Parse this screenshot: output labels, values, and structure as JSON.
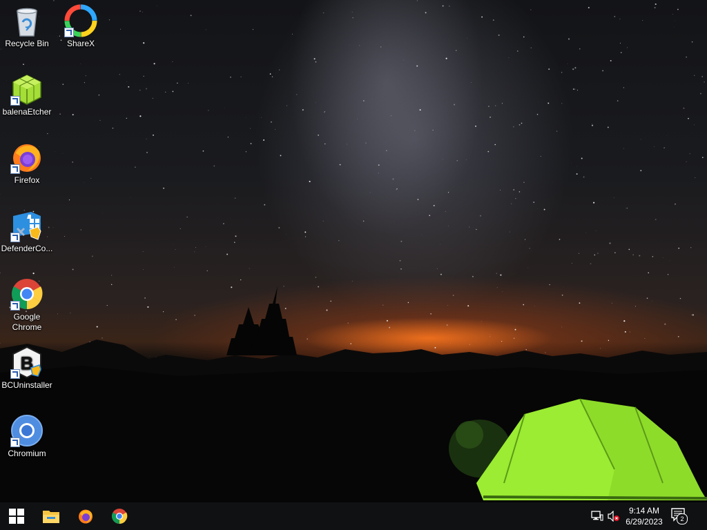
{
  "desktop": {
    "icons": [
      {
        "label": "Recycle Bin",
        "icon": "recycle-bin-icon",
        "shortcut": false
      },
      {
        "label": "ShareX",
        "icon": "sharex-icon",
        "shortcut": true
      },
      {
        "label": "balenaEtcher",
        "icon": "balena-etcher-icon",
        "shortcut": true
      },
      {
        "label": "Firefox",
        "icon": "firefox-icon",
        "shortcut": true
      },
      {
        "label": "DefenderCo...",
        "icon": "defender-control-icon",
        "shortcut": true
      },
      {
        "label": "Google Chrome",
        "icon": "chrome-icon",
        "shortcut": true
      },
      {
        "label": "BCUninstaller",
        "icon": "bcuninstaller-icon",
        "shortcut": true
      },
      {
        "label": "Chromium",
        "icon": "chromium-icon",
        "shortcut": true
      }
    ],
    "wallpaper": "night-sky-milky-way-tent"
  },
  "taskbar": {
    "start_icon": "windows-start-icon",
    "pinned": [
      {
        "app": "File Explorer",
        "icon": "file-explorer-icon"
      },
      {
        "app": "Firefox",
        "icon": "firefox-icon"
      },
      {
        "app": "Google Chrome",
        "icon": "chrome-icon"
      }
    ],
    "tray": {
      "network_icon": "network-icon",
      "volume_icon": "volume-muted-icon",
      "time": "9:14 AM",
      "date": "6/29/2023",
      "notification_count": "2"
    }
  },
  "colors": {
    "taskbar_bg": "#101113",
    "tent_green": "#8edc2a",
    "horizon_glow": "#ff7a1e"
  }
}
